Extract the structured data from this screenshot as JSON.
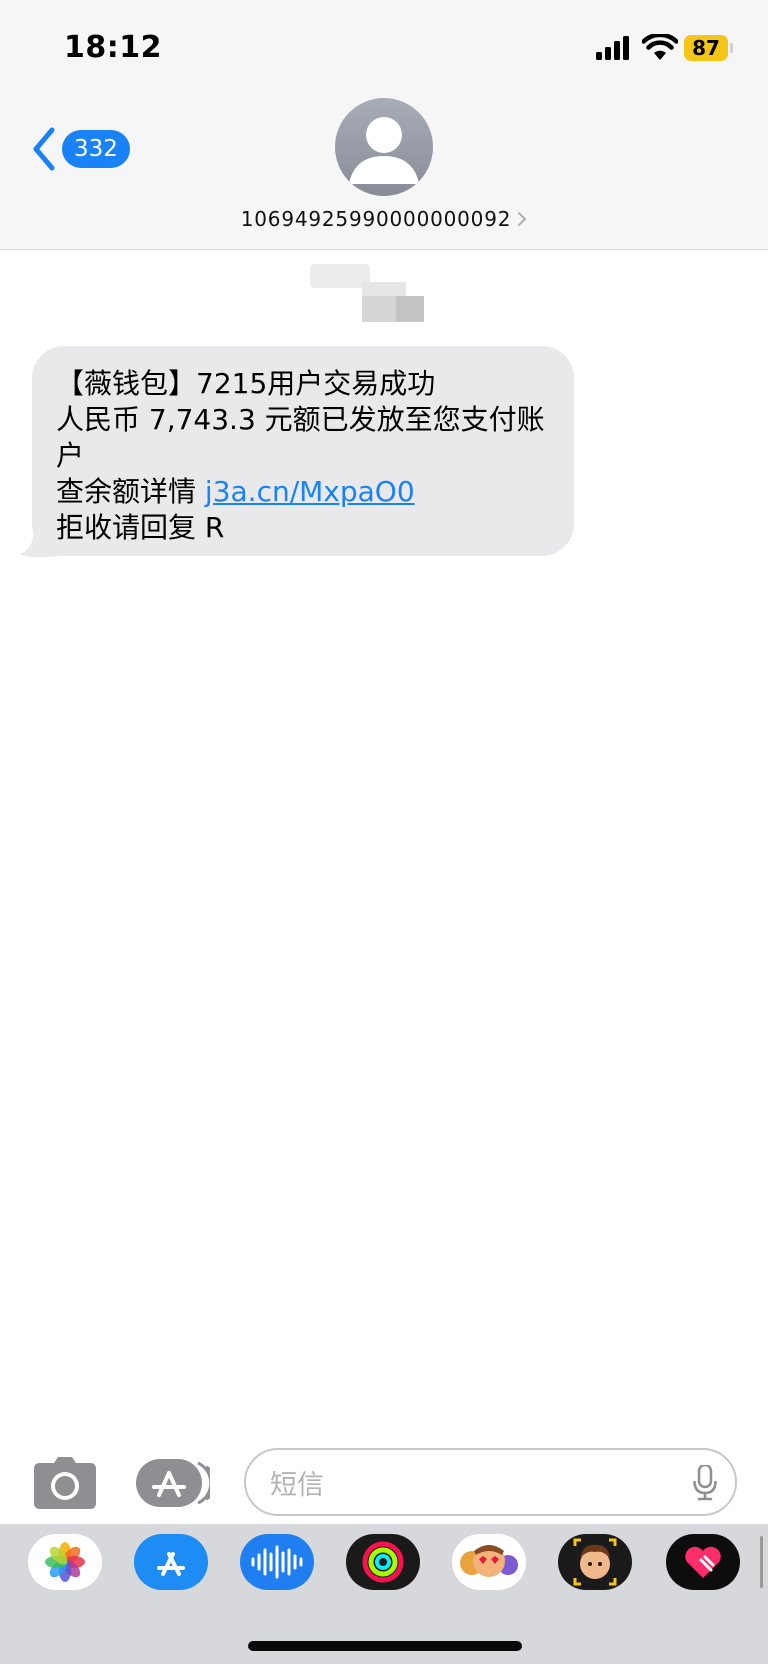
{
  "status_bar": {
    "time": "18:12",
    "battery": "87",
    "battery_color": "#f5c518"
  },
  "header": {
    "back_count": "332",
    "sender_number": "10694925990000000092",
    "avatar_icon": "person-placeholder-icon"
  },
  "message": {
    "lines": [
      "【薇钱包】7215用户交易成功",
      "人民币 7,743.3 元额已发放至您支付账户",
      "查余额详情"
    ],
    "link": "j3a.cn/MxpaO0",
    "last_line": "拒收请回复 R",
    "bubble_color": "#e9e9eb",
    "link_color": "#1a82f7"
  },
  "compose": {
    "placeholder": "短信",
    "camera_icon": "camera-icon",
    "apps_icon": "app-store-icon",
    "mic_icon": "microphone-icon"
  },
  "app_drawer": {
    "apps": [
      "photos",
      "app-store",
      "audio-message",
      "fitness",
      "memoji-stickers",
      "memoji",
      "digital-touch"
    ]
  },
  "colors": {
    "accent": "#1a82f7",
    "header_bg": "#f6f6f6",
    "drawer_bg": "#d7d8dc"
  }
}
